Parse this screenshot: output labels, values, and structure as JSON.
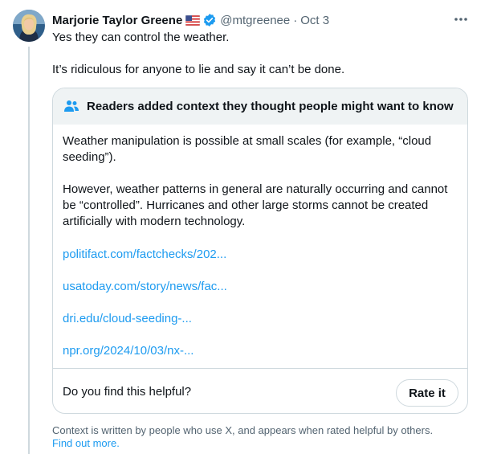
{
  "post": {
    "author_name": "Marjorie Taylor Greene",
    "handle": "@mtgreenee",
    "separator": "·",
    "date": "Oct 3",
    "text_line1": "Yes they can control the weather.",
    "text_line2": "It’s ridiculous for anyone to lie and say it can’t be done."
  },
  "note": {
    "heading": "Readers added context they thought people might want to know",
    "paragraphs": [
      "Weather manipulation is possible at small scales (for example, “cloud seeding”).",
      "However, weather patterns in general are naturally occurring and cannot be “controlled”. Hurricanes and other large storms cannot be created artificially with modern technology."
    ],
    "links": [
      "politifact.com/factchecks/202...",
      "usatoday.com/story/news/fac...",
      "dri.edu/cloud-seeding-...",
      "npr.org/2024/10/03/nx-..."
    ],
    "helpful_question": "Do you find this helpful?",
    "rate_button": "Rate it"
  },
  "footer": {
    "text": "Context is written by people who use X, and appears when rated helpful by others.",
    "link": "Find out more."
  },
  "colors": {
    "link": "#1d9bf0",
    "verified": "#1d9bf0",
    "secondary_text": "#536471",
    "border": "#cfd9de",
    "note_header_bg": "#eff3f4"
  },
  "icons": [
    "avatar-photo",
    "us-flag-icon",
    "verified-badge-icon",
    "more-options-icon",
    "people-icon"
  ]
}
